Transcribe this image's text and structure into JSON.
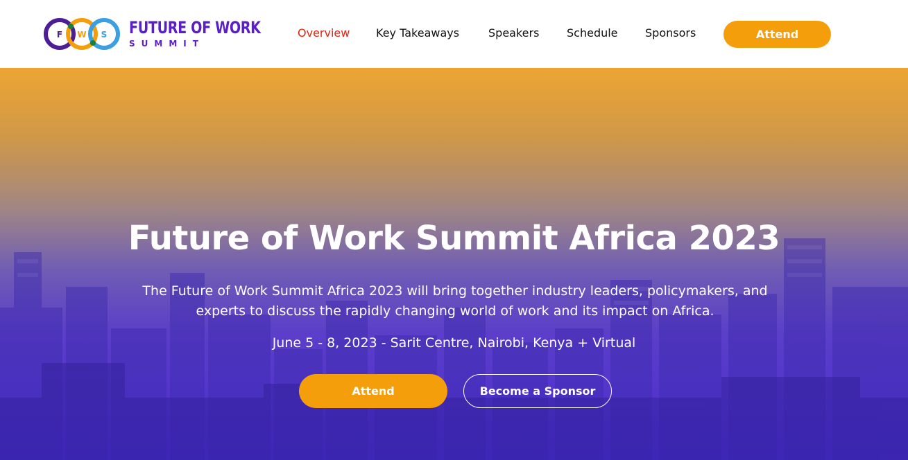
{
  "logo": {
    "letters": [
      "F",
      "W",
      "S"
    ],
    "line1": "FUTURE OF WORK",
    "line2": "SUMMIT",
    "colors": {
      "ring1": "#4c1d95",
      "ring2": "#f59e0b",
      "ring3": "#3b9fe0",
      "text": "#5b1fc9"
    }
  },
  "nav": {
    "items": [
      {
        "label": "Overview",
        "active": true
      },
      {
        "label": "Key Takeaways",
        "active": false
      },
      {
        "label": "Speakers",
        "active": false
      },
      {
        "label": "Schedule",
        "active": false
      },
      {
        "label": "Sponsors",
        "active": false
      }
    ],
    "attend_label": "Attend"
  },
  "hero": {
    "title": "Future of Work Summit Africa 2023",
    "description": "The Future of Work Summit Africa 2023 will bring together industry leaders, policymakers, and experts to discuss the rapidly changing world of work and its impact on Africa.",
    "date_location": "June 5 - 8, 2023 - Sarit Centre, Nairobi, Kenya + Virtual",
    "primary_button": "Attend",
    "secondary_button": "Become a Sponsor"
  },
  "colors": {
    "accent": "#f59e0b",
    "active_nav": "#e8210f",
    "hero_top": "#e8a838",
    "hero_bottom": "#4e2fd0"
  }
}
